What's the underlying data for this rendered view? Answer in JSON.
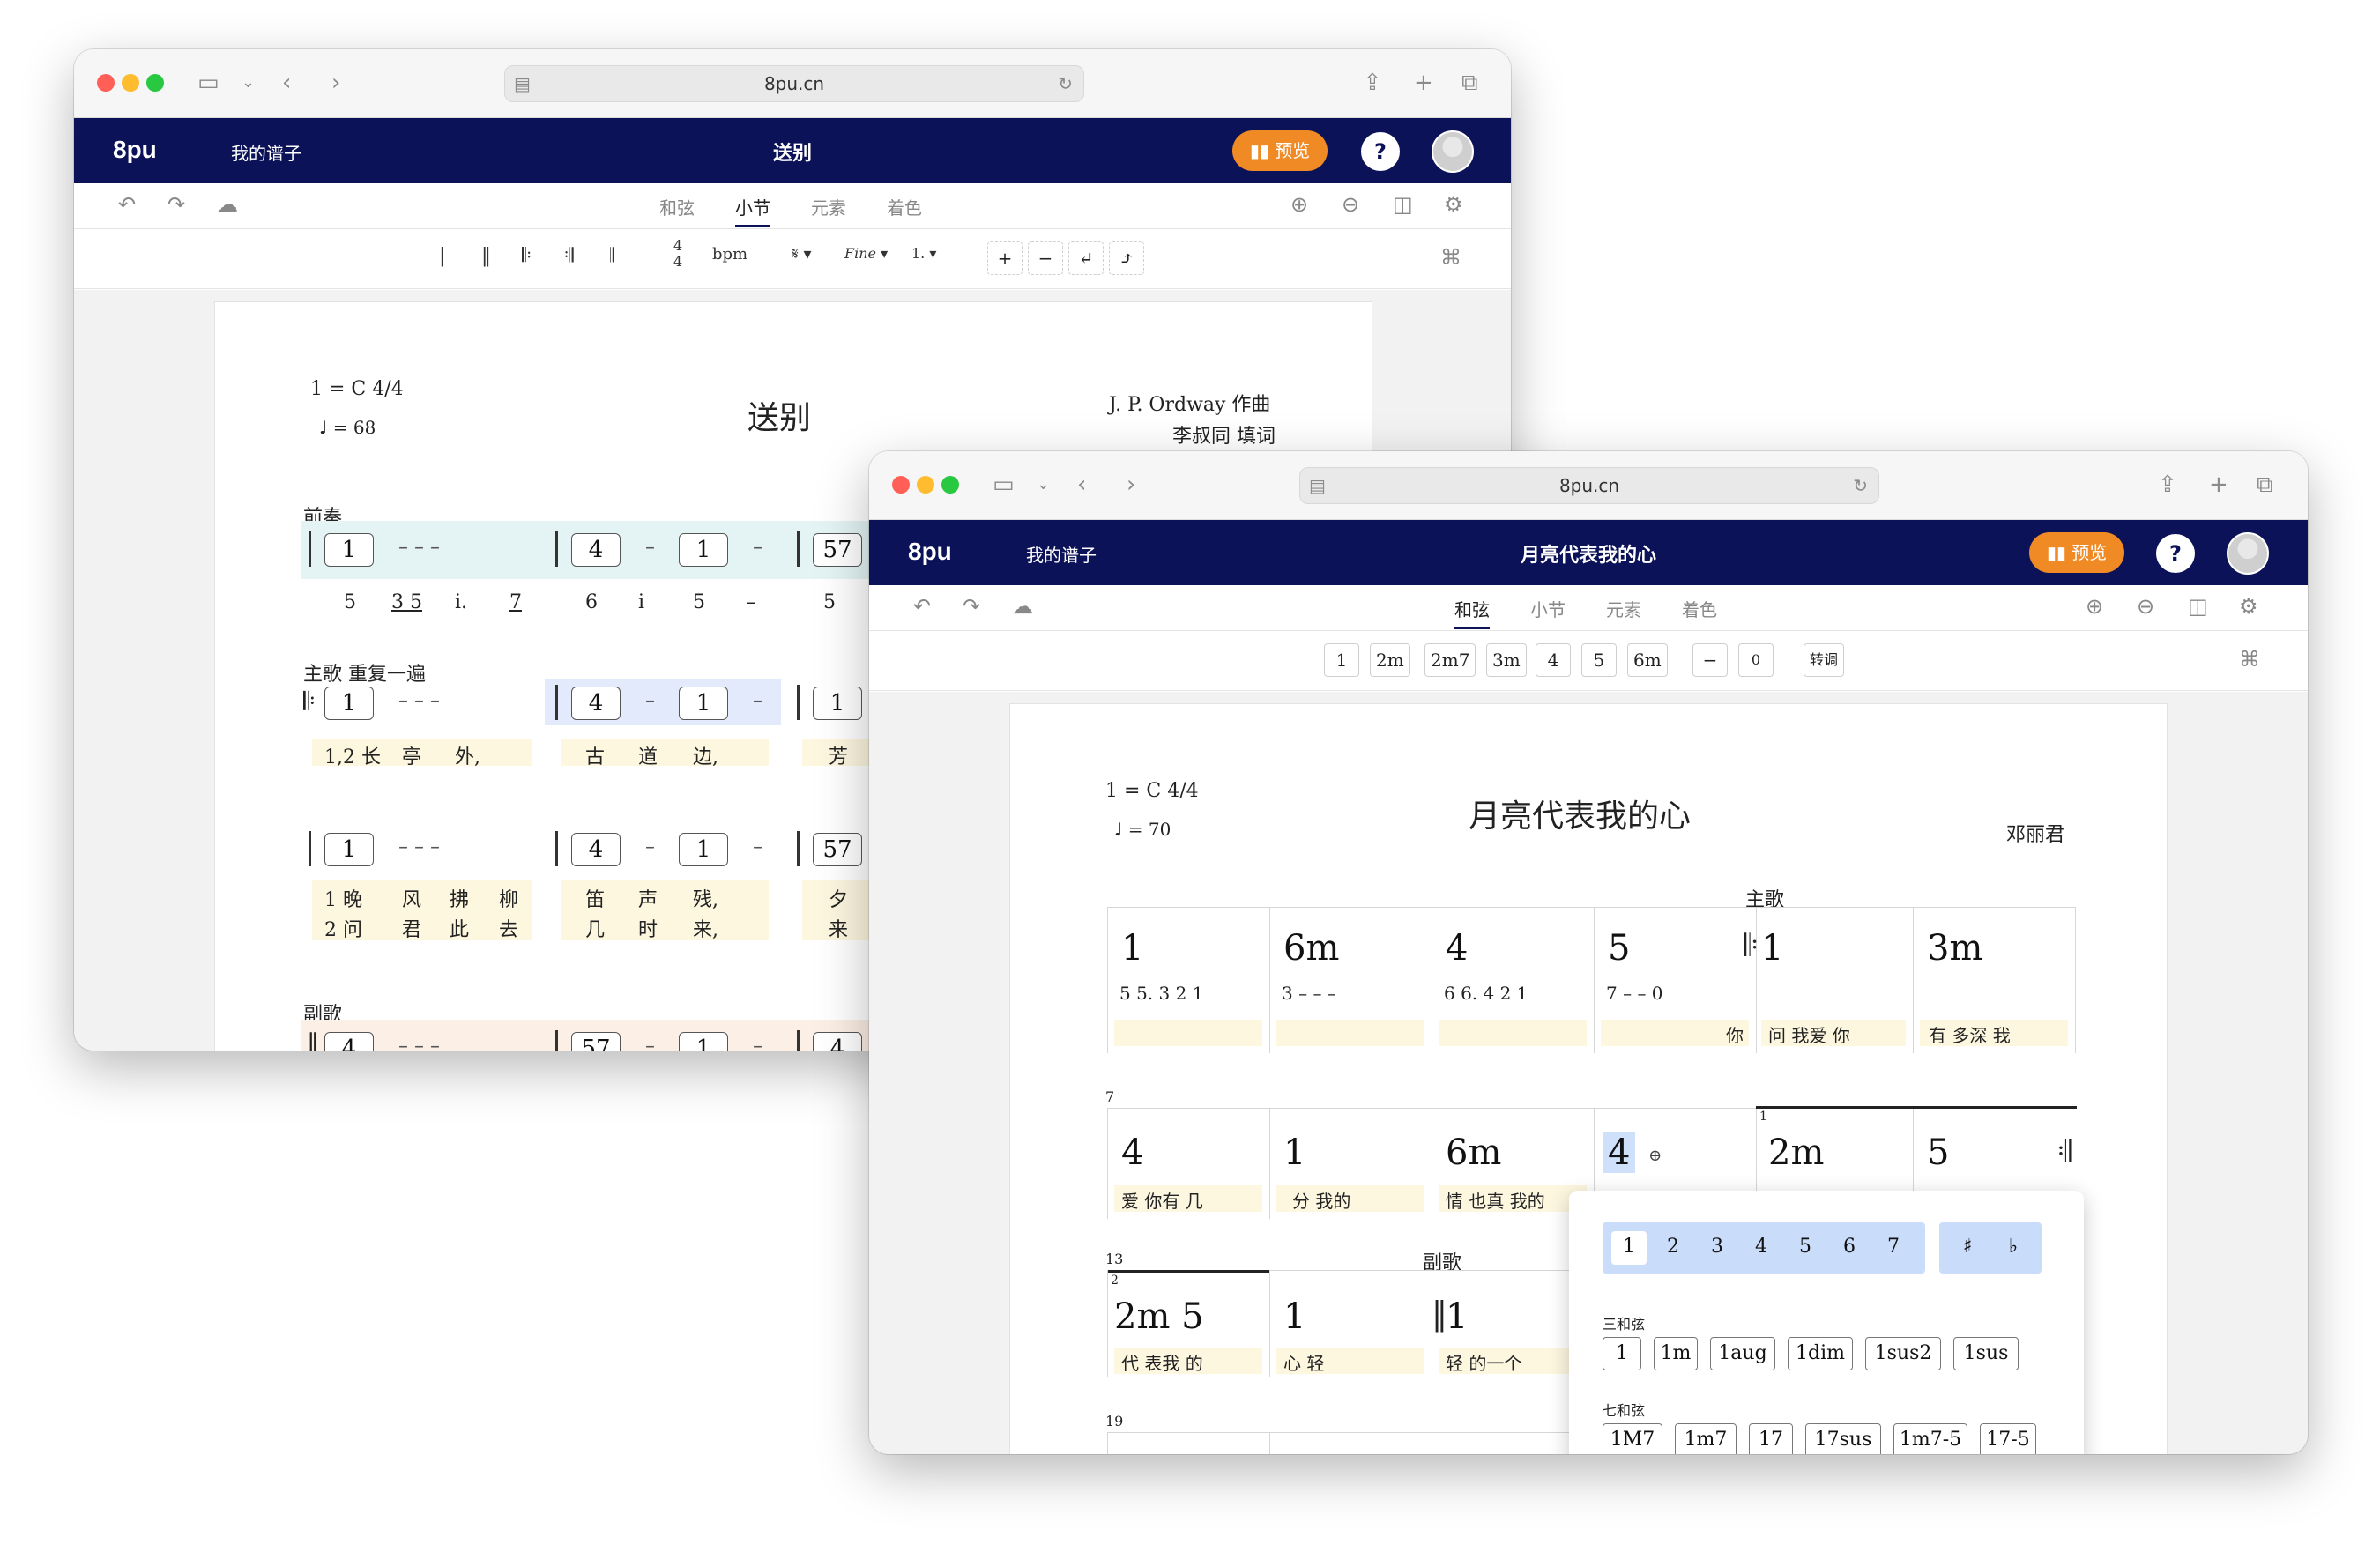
{
  "win1": {
    "url": "8pu.cn",
    "logo": "8pu",
    "my_scores": "我的谱子",
    "title": "送别",
    "preview": "预览",
    "help": "?",
    "tabs": [
      "和弦",
      "小节",
      "元素",
      "着色"
    ],
    "toolbar": {
      "time_top": "4",
      "time_bottom": "4",
      "bpm": "bpm",
      "segno": "𝄋",
      "fine": "Fine",
      "volta": "1.",
      "plus": "+",
      "minus": "−"
    },
    "score": {
      "key": "1 = C   4/4",
      "tempo": "♩ = 68",
      "heading": "送别",
      "composer": "J. P. Ordway 作曲",
      "lyricist": "李叔同 填词",
      "sec1": "前奏",
      "sec2": "主歌 重复一遍",
      "sec3": "副歌",
      "row1_chords": [
        "1",
        "4",
        "1",
        "57"
      ],
      "row1_notes": [
        "5",
        "3 5",
        "i.",
        "7",
        "6",
        "i",
        "5",
        "–",
        "5"
      ],
      "row2_chords": [
        "1",
        "4",
        "1",
        "1"
      ],
      "row2_lyrics": [
        "1,2 长",
        "亭",
        "外,",
        "古",
        "道",
        "边,",
        "芳"
      ],
      "row3_chords": [
        "1",
        "4",
        "1",
        "57"
      ],
      "row3_lyrics_a": [
        "1 晚",
        "风",
        "拂",
        "柳",
        "笛",
        "声",
        "残,",
        "夕"
      ],
      "row3_lyrics_b": [
        "2 问",
        "君",
        "此",
        "去",
        "几",
        "时",
        "来,",
        "来"
      ],
      "row4_chords": [
        "4",
        "57",
        "1",
        "4"
      ]
    }
  },
  "win2": {
    "url": "8pu.cn",
    "logo": "8pu",
    "my_scores": "我的谱子",
    "title": "月亮代表我的心",
    "preview": "预览",
    "help": "?",
    "tabs": [
      "和弦",
      "小节",
      "元素",
      "着色"
    ],
    "chord_chips": [
      "1",
      "2m",
      "2m7",
      "3m",
      "4",
      "5",
      "6m",
      "−",
      "0",
      "转调"
    ],
    "score": {
      "key": "1 = C   4/4",
      "tempo": "♩ = 70",
      "heading": "月亮代表我的心",
      "composer": "邓丽君",
      "sec_verse": "主歌",
      "sec_chorus": "副歌",
      "row1_chords": [
        "1",
        "6m",
        "4",
        "5",
        "1",
        "3m"
      ],
      "row1_notes": [
        "5  5.  3  2 1",
        "3  –  –  –",
        "6  6.  4  2 1",
        "7  –  –  0"
      ],
      "row1_lyrics": [
        "你",
        "问   我爱   你",
        "有   多深    我"
      ],
      "m7": "7",
      "row2_chords": [
        "4",
        "1",
        "6m",
        "4",
        "2m",
        "5"
      ],
      "row2_lyrics": [
        "爱     你有   几",
        "分      我的",
        "情     也真  我的"
      ],
      "volta1": "1",
      "m13": "13",
      "volta2": "2",
      "row3_chords": [
        "2m   5",
        "1",
        "1"
      ],
      "row3_lyrics": [
        "代   表我  的",
        "心                 轻",
        "轻   的一个"
      ],
      "m19": "19"
    },
    "popup": {
      "degrees": [
        "1",
        "2",
        "3",
        "4",
        "5",
        "6",
        "7"
      ],
      "accidentals": [
        "♯",
        "♭"
      ],
      "triads_label": "三和弦",
      "triads": [
        "1",
        "1m",
        "1aug",
        "1dim",
        "1sus2",
        "1sus"
      ],
      "sevenths_label": "七和弦",
      "sevenths": [
        "1M7",
        "1m7",
        "17",
        "17sus",
        "1m7-5",
        "17-5"
      ]
    }
  }
}
